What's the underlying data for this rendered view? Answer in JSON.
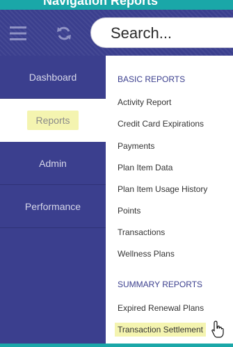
{
  "banner": {
    "text": "Navigation Reports"
  },
  "header": {
    "search_placeholder": "Search..."
  },
  "sidebar": {
    "items": [
      {
        "label": "Dashboard"
      },
      {
        "label": "Reports"
      },
      {
        "label": "Admin"
      },
      {
        "label": "Performance"
      }
    ]
  },
  "panel": {
    "basic_heading": "BASIC REPORTS",
    "basic_items": [
      "Activity Report",
      "Credit Card Expirations",
      "Payments",
      "Plan Item Data",
      "Plan Item Usage History",
      "Points",
      "Transactions",
      "Wellness Plans"
    ],
    "summary_heading": "SUMMARY REPORTS",
    "summary_items": [
      "Expired Renewal Plans",
      "Transaction Settlement"
    ]
  },
  "colors": {
    "header_bg": "#3b3f8e",
    "sidebar_bg": "#3b3f8e",
    "frame_border": "#1aa7a8",
    "highlight": "#f4f4b0",
    "heading_text": "#3b3f8e"
  },
  "icons": {
    "menu": "hamburger-menu-icon",
    "refresh": "refresh-icon",
    "pointer": "hand-pointer-icon"
  }
}
